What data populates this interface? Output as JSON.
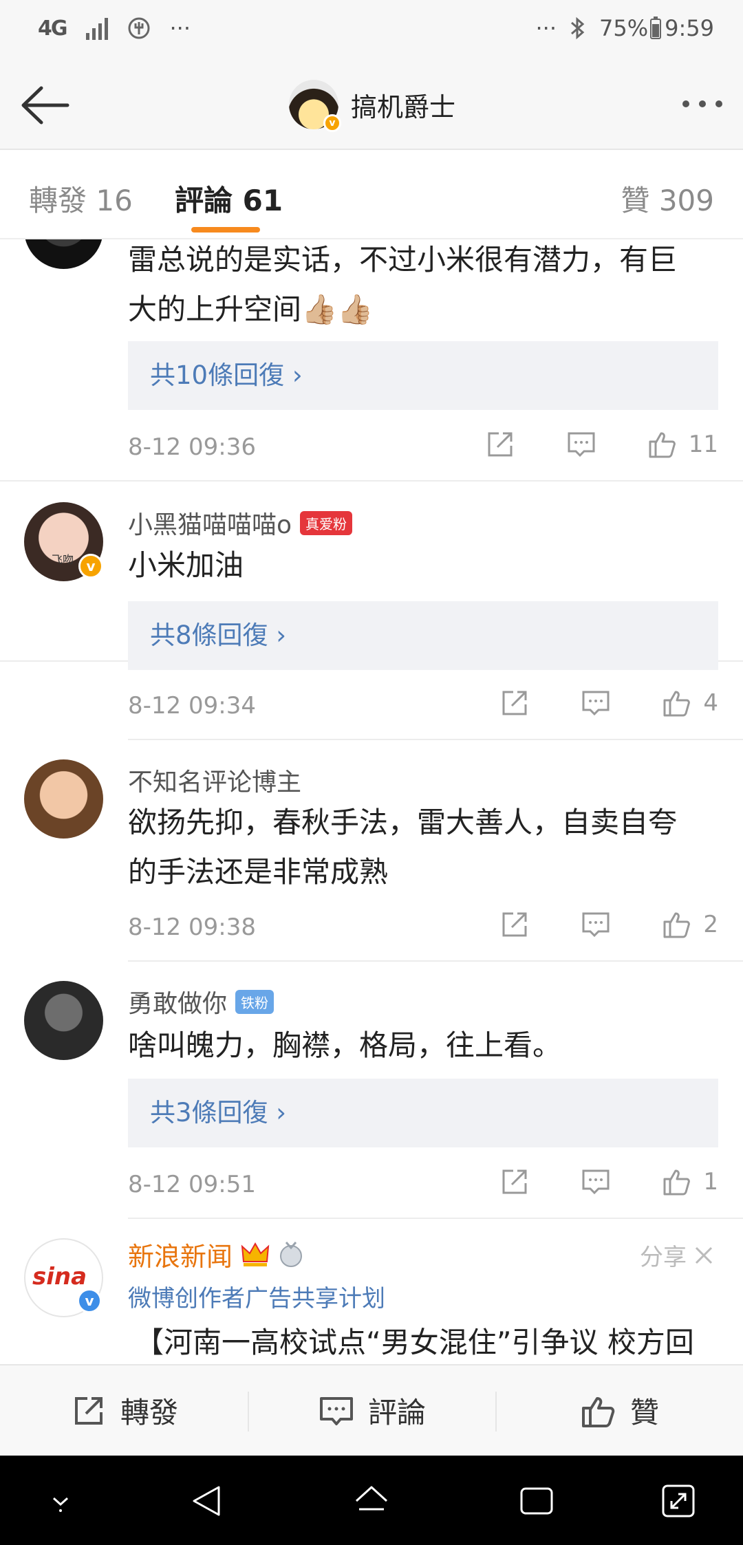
{
  "status_bar": {
    "network": "4G",
    "left_more": "···",
    "right_more": "···",
    "battery": "75%",
    "time": "9:59"
  },
  "header": {
    "title": "搞机爵士",
    "back_icon": "arrow-left-icon",
    "more_icon": "more-dots-icon"
  },
  "tabs": {
    "repost": "轉發 16",
    "comments": "評論 61",
    "likes": "贊 309"
  },
  "comments": [
    {
      "username": "",
      "text_line1": "雷总说的是实话，不过小米很有潜力，有巨",
      "text_line2": "大的上升空间👍🏼👍🏼",
      "replies": "共10條回復 ›",
      "time": "8-12 09:36",
      "likes": "11"
    },
    {
      "username": "小黑猫喵喵喵o",
      "badge": "真爱粉",
      "avatar_label": "飞吻",
      "text_line1": "小米加油",
      "replies": "共8條回復 ›",
      "time": "8-12 09:34",
      "likes": "4"
    },
    {
      "username": "不知名评论博主",
      "text_line1": "欲扬先抑，春秋手法，雷大善人，自卖自夸",
      "text_line2": "的手法还是非常成熟",
      "time": "8-12 09:38",
      "likes": "2"
    },
    {
      "username": "勇敢做你",
      "badge": "铁粉",
      "text_line1": "啥叫魄力，胸襟，格局，往上看。",
      "replies": "共3條回復 ›",
      "time": "8-12 09:51",
      "likes": "1"
    }
  ],
  "ad": {
    "name": "新浪新闻",
    "avatar_label": "sina",
    "subtitle": "微博创作者广告共享计划",
    "share": "分享",
    "text": "【河南一高校试点“男女混住”引争议 校方回"
  },
  "bottom_bar": {
    "repost": "轉發",
    "comment": "評論",
    "like": "贊"
  },
  "colors": {
    "accent_orange": "#f78a1e",
    "link_blue": "#4d7bb7",
    "badge_red": "#e5363b",
    "badge_blue": "#68a6e8"
  }
}
